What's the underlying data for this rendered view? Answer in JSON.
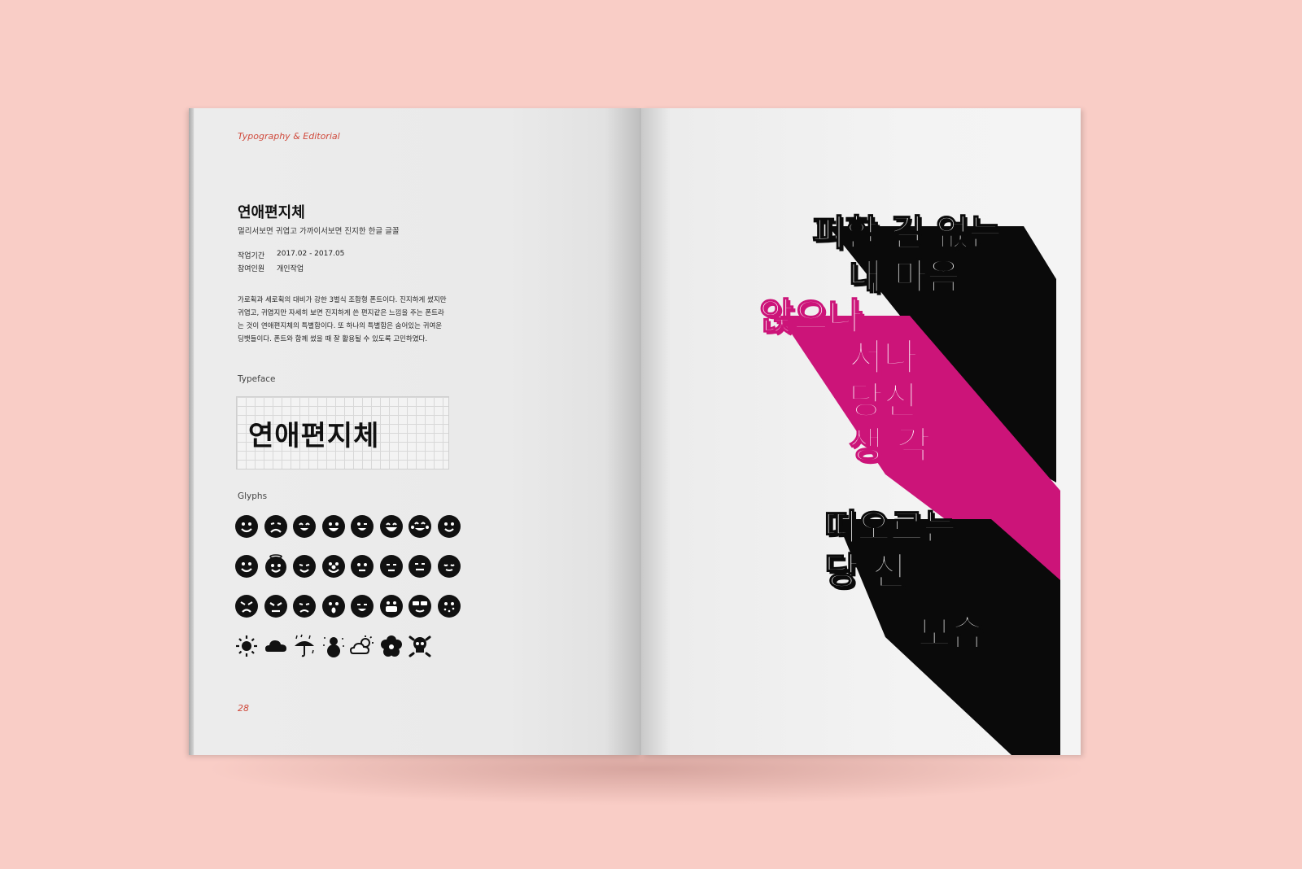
{
  "left_page": {
    "running_head": "Typography & Editorial",
    "title": "연애편지체",
    "subtitle": "멀리서보면 귀엽고 가까이서보면 진지한 한글 글꼴",
    "meta": [
      {
        "key": "작업기간",
        "value": "2017.02 - 2017.05"
      },
      {
        "key": "참여인원",
        "value": "개인작업"
      }
    ],
    "description": [
      "가로획과 세로획의 대비가 강한 3벌식 조합형 폰트이다. 진지하게 썼지만",
      "귀엽고, 귀엽지만 자세히 보면 진지하게 쓴 편지같은 느낌을 주는 폰트라",
      "는 것이 연애편지체의 특별함이다. 또 하나의 특별함은 숨어있는 귀여운",
      "딩뱃들이다. 폰트와 함께 썼을 때 잘 활용될 수 있도록 고민하였다."
    ],
    "typeface_label": "Typeface",
    "typeface_sample": "연애편지체",
    "glyphs_label": "Glyphs",
    "glyph_rows": [
      [
        "smile-face-icon",
        "sad-face-icon",
        "happy-face-icon",
        "grin-face-icon",
        "wink-face-icon",
        "laugh-face-icon",
        "tears-joy-face-icon",
        "blush-face-icon"
      ],
      [
        "smile-face-icon",
        "angel-face-icon",
        "devil-face-icon",
        "clown-face-icon",
        "neutral-face-icon",
        "flat-face-icon",
        "straight-face-icon",
        "calm-face-icon"
      ],
      [
        "angry-face-icon",
        "mad-face-icon",
        "sweat-face-icon",
        "surprised-face-icon",
        "sleepy-face-icon",
        "mask-face-icon",
        "sunglasses-face-icon",
        "sick-face-icon"
      ],
      [
        "sun-icon",
        "cloud-icon",
        "umbrella-rain-icon",
        "snowman-icon",
        "partly-cloudy-icon",
        "flower-icon",
        "skull-icon"
      ]
    ],
    "page_number": "28"
  },
  "right_page": {
    "poster_lines": [
      {
        "text": "피할 길 없는",
        "color": "black"
      },
      {
        "text": "내 마음",
        "color": "black"
      },
      {
        "text": "앉으나",
        "color": "magenta"
      },
      {
        "text": "서나",
        "color": "magenta"
      },
      {
        "text": "당신",
        "color": "magenta"
      },
      {
        "text": "생 각",
        "color": "magenta"
      },
      {
        "text": "떠오르는",
        "color": "black"
      },
      {
        "text": "당 신",
        "color": "black"
      },
      {
        "text": "모습",
        "color": "black"
      }
    ],
    "accent_magenta": "#cc1479",
    "accent_black": "#0a0a0a"
  },
  "colors": {
    "background": "#f9cdc6",
    "running_head": "#d04a3c"
  }
}
